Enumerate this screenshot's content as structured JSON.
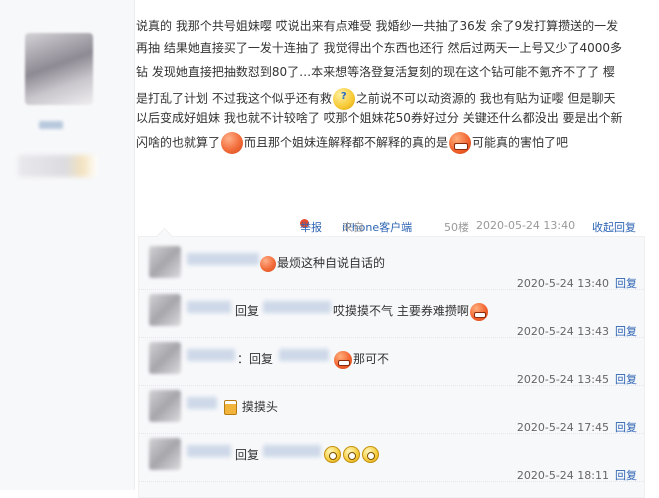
{
  "post": {
    "lines": [
      "说真的 我那个共号姐妹嘤 哎说出来有点难受 我婚纱一共抽了36发 余了9发打算攒送的一发",
      "再抽 结果她直接买了一发十连抽了 我觉得出个东西也还行 然后过两天一上号又少了4000多",
      "钻 发现她直接把抽数怼到80了…本来想等洛登复活复刻的现在这个钻可能不氪齐不了了 樱",
      "是打乱了计划 不过我这个似乎还有救",
      "之前说不可以动资源的 我也有贴为证嘤 但是聊天",
      "以后变成好姐妹 我也就不计较啥了 哎那个姐妹花50券好过分 关键还什么都没出 要是出个新",
      "闪啥的也就算了",
      "而且那个姐妹连解释都不解释的真的是",
      "可能真的害怕了吧"
    ],
    "colors": {
      "link": "#2d64b3",
      "meta": "#999999",
      "panel": "#f7f8fa"
    }
  },
  "tail": {
    "report": "举报",
    "device_prefix": "来自",
    "device": "iPhone客户端",
    "floor": "50楼",
    "date": "2020-05-24 13:40",
    "collapse": "收起回复"
  },
  "replies": [
    {
      "text": "最烦这种自说自话的",
      "time": "2020-5-24 13:40",
      "reply_label": "回复"
    },
    {
      "prefix": "回复",
      "text": "哎摸摸不气 主要券难攒啊",
      "time": "2020-5-24 13:43",
      "reply_label": "回复"
    },
    {
      "prefix": "：回复",
      "text": "那可不",
      "time": "2020-5-24 13:45",
      "reply_label": "回复"
    },
    {
      "text": "摸摸头",
      "time": "2020-5-24 17:45",
      "reply_label": "回复"
    },
    {
      "prefix": "回复",
      "text": "",
      "time": "2020-5-24 18:11",
      "reply_label": "回复"
    }
  ]
}
